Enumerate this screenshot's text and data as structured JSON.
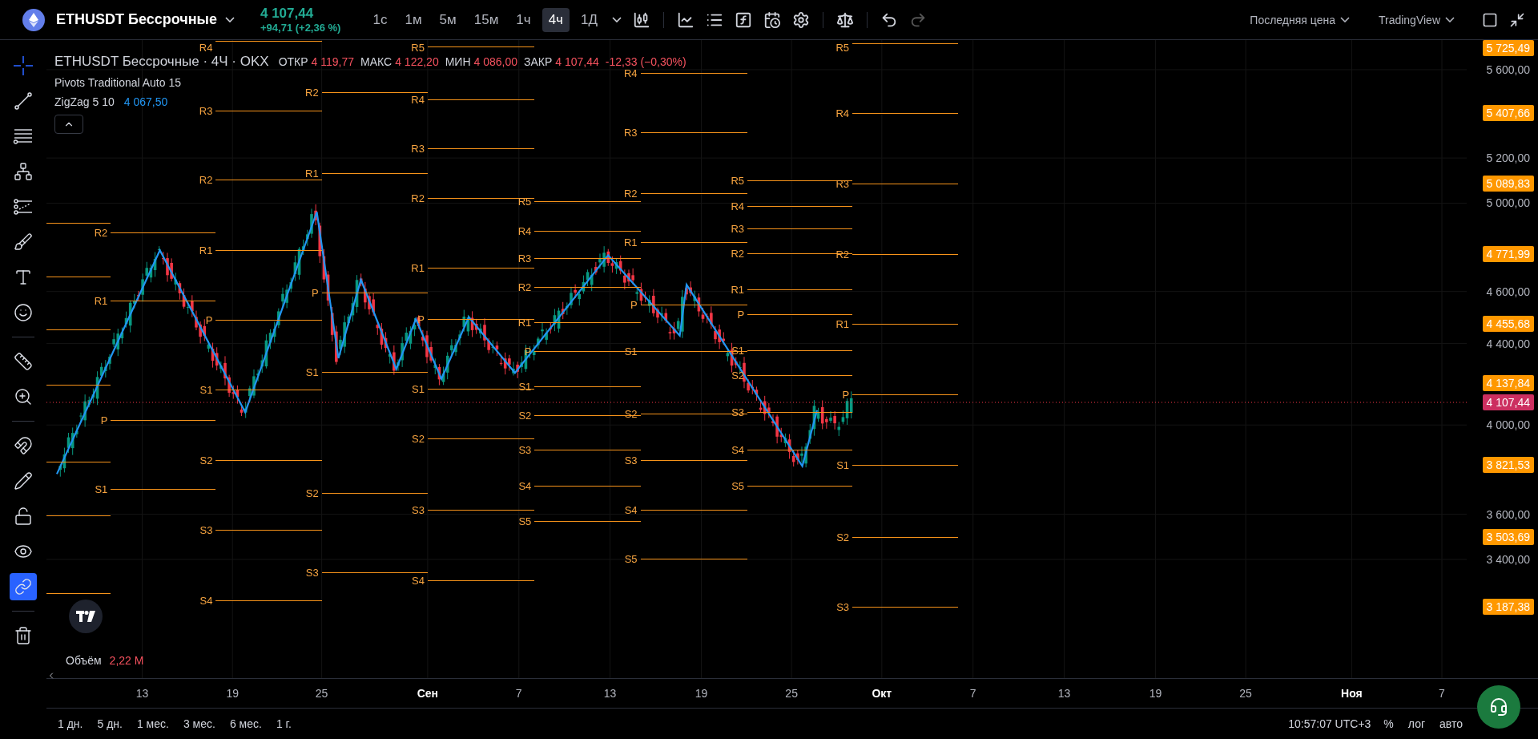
{
  "header": {
    "symbol": "ETHUSDT Бессрочные",
    "price": "4 107,44",
    "change": "+94,71 (+2,36 %)",
    "intervals": [
      {
        "label": "1с",
        "selected": false
      },
      {
        "label": "1м",
        "selected": false
      },
      {
        "label": "5м",
        "selected": false
      },
      {
        "label": "15м",
        "selected": false
      },
      {
        "label": "1ч",
        "selected": false
      },
      {
        "label": "4ч",
        "selected": true
      },
      {
        "label": "1Д",
        "selected": false
      }
    ],
    "price_mode": "Последняя цена",
    "scale_source": "TradingView",
    "redo_disabled": true
  },
  "tool_groups": [
    [
      {
        "kind": "crosshair",
        "selected": true,
        "on": false
      },
      {
        "kind": "trend-line",
        "selected": false,
        "on": false
      },
      {
        "kind": "fib",
        "selected": false,
        "on": false
      },
      {
        "kind": "pattern",
        "selected": false,
        "on": false
      },
      {
        "kind": "projection",
        "selected": false,
        "on": false
      },
      {
        "kind": "brush",
        "selected": false,
        "on": false
      },
      {
        "kind": "text",
        "selected": false,
        "on": false
      },
      {
        "kind": "emoji",
        "selected": false,
        "on": false
      }
    ],
    [
      {
        "kind": "ruler",
        "selected": false,
        "on": false
      },
      {
        "kind": "zoom",
        "selected": false,
        "on": false
      }
    ],
    [
      {
        "kind": "magnet",
        "selected": false,
        "on": false
      },
      {
        "kind": "pencil-lock",
        "selected": false,
        "on": false
      },
      {
        "kind": "lock",
        "selected": false,
        "on": false
      },
      {
        "kind": "eye",
        "selected": false,
        "on": false
      },
      {
        "kind": "link",
        "selected": false,
        "on": true
      }
    ],
    [
      {
        "kind": "trash",
        "selected": false,
        "on": false
      }
    ]
  ],
  "legend": {
    "title": "ETHUSDT Бессрочные · 4Ч · OKX",
    "ohlc": [
      {
        "label": "ОТКР",
        "value": "4 119,77"
      },
      {
        "label": "МАКС",
        "value": "4 122,20"
      },
      {
        "label": "МИН",
        "value": "4 086,00"
      },
      {
        "label": "ЗАКР",
        "value": "4 107,44"
      }
    ],
    "change": "-12,33 (−0,30%)",
    "indicators": [
      {
        "name": "Pivots Traditional Auto 15"
      },
      {
        "name": "ZigZag 5 10",
        "value": "4 067,50"
      }
    ]
  },
  "pivots": [
    {
      "labels": [
        "R2",
        "R1",
        "P",
        "S1"
      ]
    },
    {
      "labels": [
        "R4",
        "R3",
        "R2",
        "R1",
        "P",
        "S1",
        "S2",
        "S3",
        "S4"
      ]
    },
    {
      "labels": [
        "R2",
        "R1",
        "P",
        "S1",
        "S2",
        "S3"
      ]
    },
    {
      "labels": [
        "R5",
        "R4",
        "R3",
        "R2",
        "R1",
        "P",
        "S1",
        "S2",
        "S3",
        "S4"
      ]
    },
    {
      "labels": [
        "R5",
        "R4",
        "R3",
        "R2",
        "R1",
        "P",
        "S1",
        "S2",
        "S3",
        "S4",
        "S5"
      ]
    },
    {
      "labels": [
        "R4",
        "R3",
        "R2",
        "R1",
        "P",
        "S1",
        "S2",
        "S3",
        "S4",
        "S5"
      ]
    },
    {
      "labels": [
        "R5",
        "R4",
        "R3",
        "R2",
        "R1",
        "P",
        "S1",
        "S2",
        "S3",
        "S4",
        "S5"
      ]
    },
    {
      "labels": [
        "R5",
        "R4",
        "R3",
        "R2",
        "R1",
        "P",
        "S1",
        "S2",
        "S3"
      ]
    }
  ],
  "price_axis": {
    "ticks": [
      "5 600,00",
      "5 200,00",
      "5 000,00",
      "4 600,00",
      "4 400,00",
      "4 000,00",
      "3 600,00",
      "3 400,00"
    ],
    "levels": [
      {
        "label": "5 725,49",
        "kind": "pivot"
      },
      {
        "label": "5 407,66",
        "kind": "pivot"
      },
      {
        "label": "5 089,83",
        "kind": "pivot"
      },
      {
        "label": "4 771,99",
        "kind": "pivot"
      },
      {
        "label": "4 455,68",
        "kind": "pivot"
      },
      {
        "label": "4 137,84",
        "kind": "pivot"
      },
      {
        "label": "4 107,44",
        "kind": "last"
      },
      {
        "label": "3 821,53",
        "kind": "pivot"
      },
      {
        "label": "3 503,69",
        "kind": "pivot"
      },
      {
        "label": "3 187,38",
        "kind": "pivot"
      }
    ]
  },
  "volume": {
    "label": "Объём",
    "value": "2,22 M"
  },
  "time_axis": [
    {
      "label": "13",
      "bold": false
    },
    {
      "label": "19",
      "bold": false
    },
    {
      "label": "25",
      "bold": false
    },
    {
      "label": "Сен",
      "bold": true
    },
    {
      "label": "7",
      "bold": false
    },
    {
      "label": "13",
      "bold": false
    },
    {
      "label": "19",
      "bold": false
    },
    {
      "label": "25",
      "bold": false
    },
    {
      "label": "Окт",
      "bold": true
    },
    {
      "label": "7",
      "bold": false
    },
    {
      "label": "13",
      "bold": false
    },
    {
      "label": "19",
      "bold": false
    },
    {
      "label": "25",
      "bold": false
    },
    {
      "label": "Ноя",
      "bold": true
    },
    {
      "label": "7",
      "bold": false
    }
  ],
  "ranges": [
    "1 дн.",
    "5 дн.",
    "1 мес.",
    "3 мес.",
    "6 мес.",
    "1 г."
  ],
  "status": {
    "time": "10:57:07 UTC+3",
    "percent": "%",
    "log": "лог",
    "auto": "авто"
  }
}
